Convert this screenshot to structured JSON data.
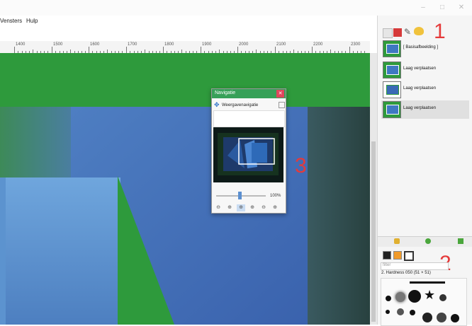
{
  "menu": {
    "items": [
      "Vensters",
      "Hulp"
    ]
  },
  "ruler": {
    "labels": [
      "1400",
      "1500",
      "1600",
      "1700",
      "1800",
      "1900",
      "2000",
      "2100",
      "2200",
      "2300"
    ]
  },
  "layers": {
    "items": [
      {
        "label": "[ Basisafbeelding ]"
      },
      {
        "label": "Laag verplaatsen"
      },
      {
        "label": "Laag verplaatsen"
      },
      {
        "label": "Laag verplaatsen"
      }
    ]
  },
  "brushes": {
    "filter_placeholder": "filter",
    "selected_brush": "2. Hardness 050 (51 × 51)"
  },
  "navigation": {
    "title": "Navigatie",
    "subtitle": "Weergavenavigatie",
    "zoom_level": "100%"
  },
  "annotations": {
    "one": "1",
    "two": "2",
    "three": "3"
  },
  "colors": {
    "canvas_green": "#2e9a3c",
    "canvas_blue": "#3e6fb6",
    "nav_title_bar": "#37a058",
    "close_red": "#e0455c",
    "annotation_red": "#e53a3a"
  },
  "icons": [
    "minimize-icon",
    "maximize-icon",
    "close-icon",
    "move-icon",
    "zoom-out-icon",
    "zoom-in-icon",
    "zoom-fit-icon"
  ]
}
